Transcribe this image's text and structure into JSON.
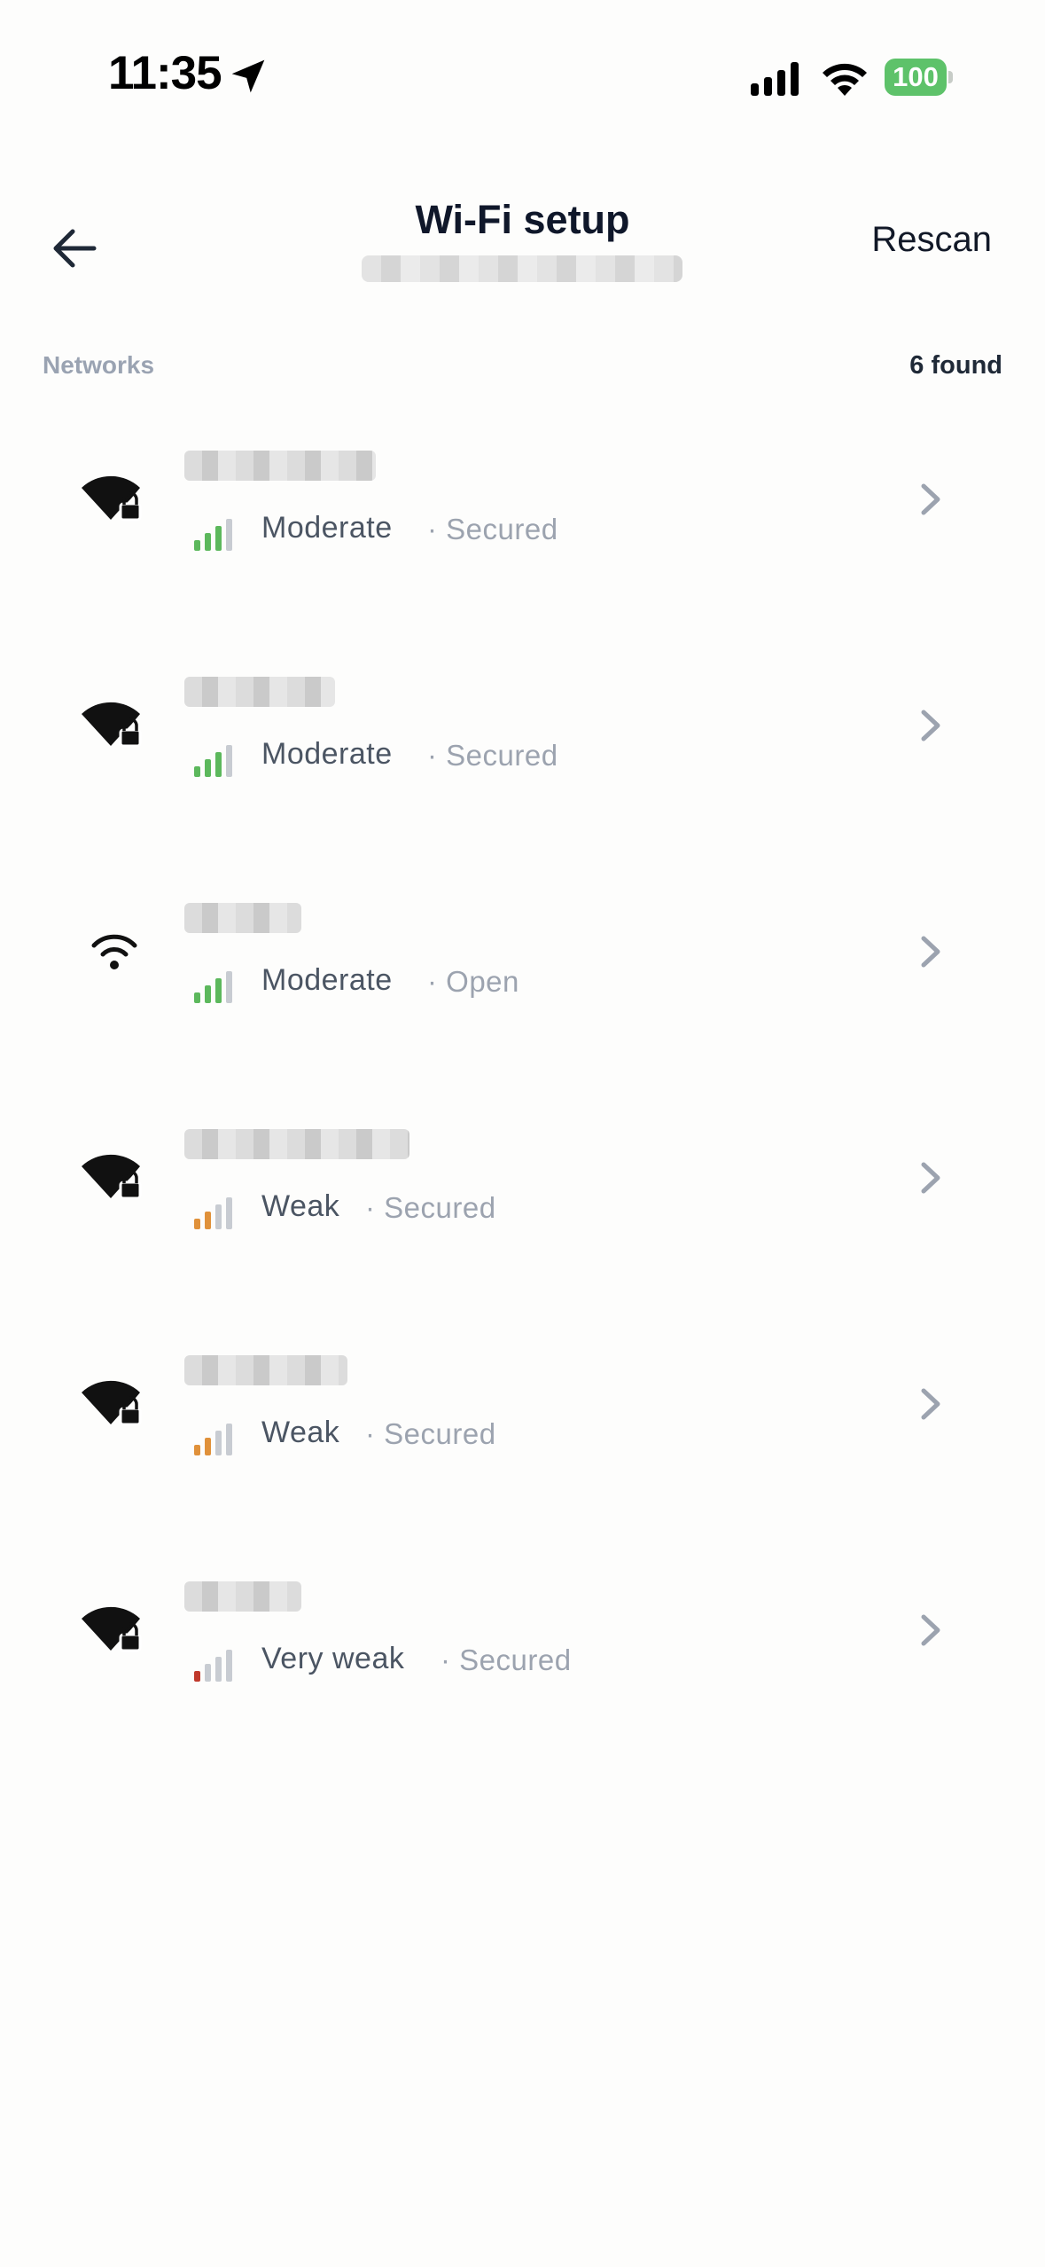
{
  "status_bar": {
    "time": "11:35",
    "battery": "100",
    "icons": [
      "location-arrow-icon",
      "cellular-signal-icon",
      "wifi-icon",
      "battery-icon"
    ],
    "battery_color": "#5ec26a"
  },
  "header": {
    "title": "Wi-Fi setup",
    "rescan_label": "Rescan",
    "back_icon": "arrow-left-icon"
  },
  "section": {
    "label": "Networks",
    "count": "6 found"
  },
  "colors": {
    "signal_green": "#5cb85c",
    "signal_orange": "#e0913a",
    "signal_red": "#c0392b",
    "signal_inactive": "#c8ccd2",
    "chevron": "#9ca3af"
  },
  "networks": [
    {
      "signal": "Moderate",
      "security": "· Secured",
      "secured": true,
      "level": 3,
      "icon": "wifi-lock-icon"
    },
    {
      "signal": "Moderate",
      "security": "· Secured",
      "secured": true,
      "level": 3,
      "icon": "wifi-lock-icon"
    },
    {
      "signal": "Moderate",
      "security": "· Open",
      "secured": false,
      "level": 3,
      "icon": "wifi-icon"
    },
    {
      "signal": "Weak",
      "security": "· Secured",
      "secured": true,
      "level": 2,
      "icon": "wifi-lock-icon"
    },
    {
      "signal": "Weak",
      "security": "· Secured",
      "secured": true,
      "level": 2,
      "icon": "wifi-lock-icon"
    },
    {
      "signal": "Very weak",
      "security": "· Secured",
      "secured": true,
      "level": 1,
      "icon": "wifi-lock-icon"
    }
  ]
}
